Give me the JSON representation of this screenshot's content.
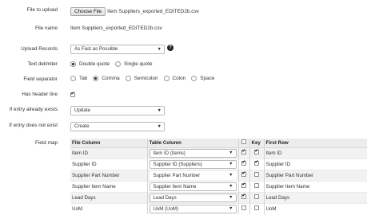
{
  "labels": {
    "file_to_upload": "File to upload",
    "file_name": "File name",
    "upload_records": "Upload Records",
    "text_delimiter": "Text delimiter",
    "field_separator": "Field separator",
    "has_header_line": "Has header line",
    "if_entry_exists": "If entry already exists",
    "if_entry_not_exist": "If entry does not exist",
    "field_map": "Field map"
  },
  "file": {
    "choose_button": "Choose File",
    "chosen_file": "Item Suppliers_exported_EDITED2b.csv",
    "file_name_value": "Item Suppliers_exported_EDITED2b.csv"
  },
  "upload_records": {
    "selected": "As Fast as Possible",
    "help_icon": "?"
  },
  "text_delimiter": {
    "options": [
      {
        "label": "Double quote",
        "selected": true
      },
      {
        "label": "Single quote",
        "selected": false
      }
    ]
  },
  "field_separator": {
    "options": [
      {
        "label": "Tab",
        "selected": false
      },
      {
        "label": "Comma",
        "selected": true
      },
      {
        "label": "Semicolon",
        "selected": false
      },
      {
        "label": "Colon",
        "selected": false
      },
      {
        "label": "Space",
        "selected": false
      }
    ]
  },
  "has_header_line": {
    "checked": true
  },
  "if_entry_exists": {
    "selected": "Update"
  },
  "if_entry_not_exist": {
    "selected": "Create"
  },
  "field_map": {
    "headers": {
      "file_column": "File Column",
      "table_column": "Table Column",
      "key": "Key",
      "first_row": "First Row"
    },
    "rows": [
      {
        "file_column": "Item ID",
        "table_column": "Item ID (Items)",
        "include": true,
        "key": true,
        "first_row": "Item ID"
      },
      {
        "file_column": "Supplier ID",
        "table_column": "Supplier ID (Suppliers)",
        "include": true,
        "key": true,
        "first_row": "Supplier ID"
      },
      {
        "file_column": "Supplier Part Number",
        "table_column": "Supplier Part Number",
        "include": true,
        "key": false,
        "first_row": "Supplier Part Number"
      },
      {
        "file_column": "Supplier Item Name",
        "table_column": "Supplier Item Name",
        "include": true,
        "key": false,
        "first_row": "Supplier Item Name"
      },
      {
        "file_column": "Lead Days",
        "table_column": "Lead Days",
        "include": true,
        "key": false,
        "first_row": "Lead Days"
      },
      {
        "file_column": "UoM",
        "table_column": "UoM (UoM)",
        "include": false,
        "key": false,
        "first_row": "UoM"
      }
    ]
  },
  "icons": {
    "dropdown": "caret-down-icon",
    "checkmark": "check-icon"
  }
}
